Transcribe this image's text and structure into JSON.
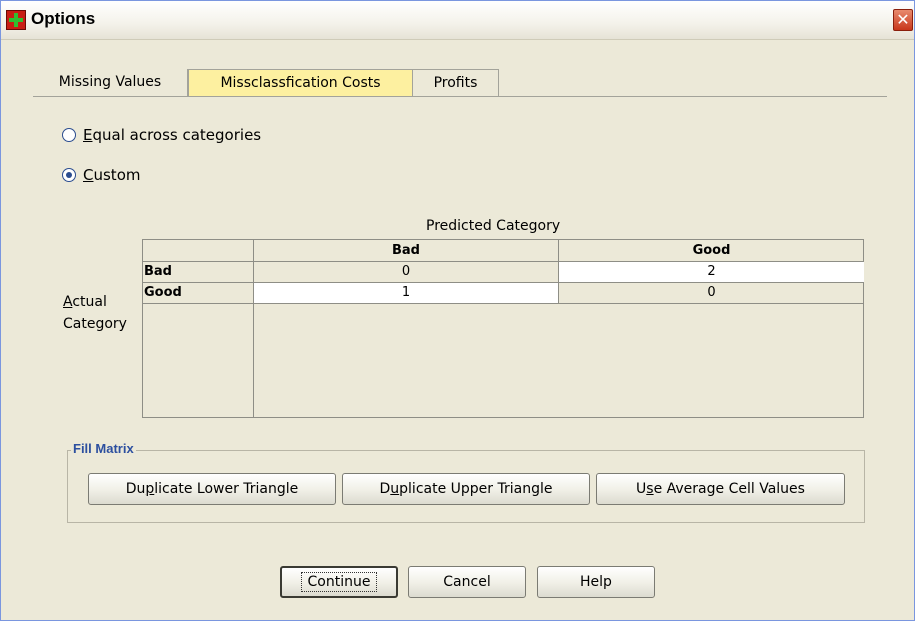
{
  "window": {
    "title": "Options",
    "close_glyph": "✕",
    "title_icon": "spss-options-icon"
  },
  "tabs": [
    {
      "label": "Missing Values",
      "active": false
    },
    {
      "label": "Missclassfication Costs",
      "active": true
    },
    {
      "label": "Profits",
      "active": false
    }
  ],
  "cost_mode": {
    "equal": {
      "label_ul": "E",
      "label_rest": "qual across categories",
      "checked": false
    },
    "custom": {
      "label_ul": "C",
      "label_rest": "ustom",
      "checked": true
    }
  },
  "matrix": {
    "predicted_label": "Predicted Category",
    "actual_label_ul": "A",
    "actual_label_rest": "ctual",
    "actual_label_line2": "Category",
    "columns": [
      "Bad",
      "Good"
    ],
    "rows": [
      {
        "label": "Bad",
        "values": [
          "0",
          "2"
        ]
      },
      {
        "label": "Good",
        "values": [
          "1",
          "0"
        ]
      }
    ]
  },
  "fill_matrix": {
    "title": "Fill Matrix",
    "buttons": {
      "lower": {
        "pre": "Du",
        "ul": "p",
        "post": "licate Lower Triangle"
      },
      "upper": {
        "pre": "D",
        "ul": "u",
        "post": "plicate Upper Triangle"
      },
      "average": {
        "pre": "U",
        "ul": "s",
        "post": "e Average Cell Values"
      }
    }
  },
  "footer": {
    "continue": "Continue",
    "cancel": "Cancel",
    "help": "Help"
  }
}
